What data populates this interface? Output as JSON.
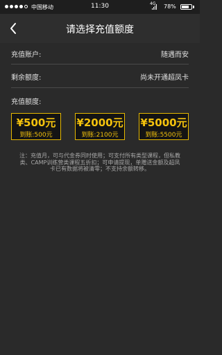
{
  "status_bar": {
    "carrier": "中国移动",
    "time": "11:30",
    "network": "4G",
    "battery_percent": "78%",
    "battery_level": 0.78,
    "signal_strength": 4,
    "signal_max": 5
  },
  "header": {
    "title": "请选择充值额度"
  },
  "info": {
    "account_label": "充值账户:",
    "account_value": "随遇而安",
    "balance_label": "剩余额度:",
    "balance_value": "尚未开通超凤卡",
    "amount_label": "充值额度:"
  },
  "options": [
    {
      "amount": "¥500元",
      "credited": "到账:500元"
    },
    {
      "amount": "¥2000元",
      "credited": "到账:2100元"
    },
    {
      "amount": "¥5000元",
      "credited": "到账:5500元"
    }
  ],
  "note": "注：充值月，可与代金券同时使用；可支付所有类型课程，但私教类、CAMP训练营类课程五折扣；可申请提现，单赠送金额及超凤卡已有数据将被清零；不支持余额转移。",
  "colors": {
    "background": "#2a2a2a",
    "accent": "#f4c20d",
    "card_border": "#e6b800"
  }
}
